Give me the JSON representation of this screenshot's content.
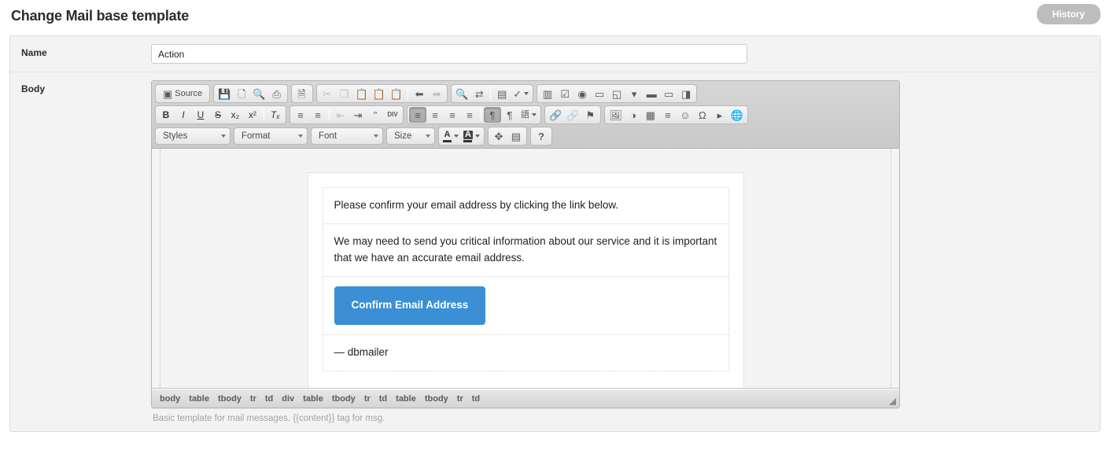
{
  "header": {
    "title": "Change Mail base template",
    "history_label": "History"
  },
  "form": {
    "name_row": {
      "label": "Name",
      "value": "Action",
      "placeholder": ""
    },
    "body_row": {
      "label": "Body",
      "help_text": "Basic template for mail messages. {{content}} tag for msg."
    }
  },
  "editor": {
    "toolbar_row1": [
      {
        "group": "document",
        "buttons": [
          {
            "name": "source-button",
            "label": "Source",
            "icon": "source-icon",
            "glyph": "▣",
            "state": "normal",
            "wide": true
          }
        ]
      },
      {
        "group": "document-2",
        "buttons": [
          {
            "name": "save-button",
            "label": "",
            "icon": "save-icon",
            "glyph": "💾",
            "state": "normal"
          },
          {
            "name": "new-page-button",
            "label": "",
            "icon": "new-page-icon",
            "glyph": "🗋",
            "state": "normal"
          },
          {
            "name": "preview-button",
            "label": "",
            "icon": "preview-icon",
            "glyph": "🔍",
            "state": "normal"
          },
          {
            "name": "print-button",
            "label": "",
            "icon": "print-icon",
            "glyph": "⎙",
            "state": "normal"
          }
        ]
      },
      {
        "group": "templates",
        "buttons": [
          {
            "name": "templates-button",
            "label": "",
            "icon": "templates-icon",
            "glyph": "🗎",
            "state": "normal"
          }
        ]
      },
      {
        "group": "clipboard",
        "buttons": [
          {
            "name": "cut-button",
            "label": "",
            "icon": "scissors-icon",
            "glyph": "✂",
            "state": "disabled"
          },
          {
            "name": "copy-button",
            "label": "",
            "icon": "copy-icon",
            "glyph": "❐",
            "state": "disabled"
          },
          {
            "name": "paste-button",
            "label": "",
            "icon": "paste-icon",
            "glyph": "📋",
            "state": "normal"
          },
          {
            "name": "paste-text-button",
            "label": "",
            "icon": "paste-text-icon",
            "glyph": "📋",
            "state": "normal"
          },
          {
            "name": "paste-word-button",
            "label": "",
            "icon": "paste-word-icon",
            "glyph": "📋",
            "state": "normal"
          },
          {
            "name": "separator",
            "label": "",
            "icon": "separator",
            "glyph": "",
            "state": "sep"
          },
          {
            "name": "undo-button",
            "label": "",
            "icon": "undo-icon",
            "glyph": "⬅",
            "state": "normal"
          },
          {
            "name": "redo-button",
            "label": "",
            "icon": "redo-icon",
            "glyph": "➡",
            "state": "disabled"
          }
        ]
      },
      {
        "group": "editing",
        "buttons": [
          {
            "name": "find-button",
            "label": "",
            "icon": "search-icon",
            "glyph": "🔍",
            "state": "normal"
          },
          {
            "name": "replace-button",
            "label": "",
            "icon": "replace-icon",
            "glyph": "⇄",
            "state": "normal"
          },
          {
            "name": "separator",
            "label": "",
            "icon": "separator",
            "glyph": "",
            "state": "sep"
          },
          {
            "name": "select-all-button",
            "label": "",
            "icon": "select-all-icon",
            "glyph": "▤",
            "state": "normal"
          },
          {
            "name": "spellcheck-button",
            "label": "",
            "icon": "spellcheck-icon",
            "glyph": "✓",
            "state": "menu"
          }
        ]
      },
      {
        "group": "forms",
        "buttons": [
          {
            "name": "form-button",
            "label": "",
            "icon": "form-icon",
            "glyph": "▥",
            "state": "normal"
          },
          {
            "name": "checkbox-button",
            "label": "",
            "icon": "checkbox-icon",
            "glyph": "☑",
            "state": "normal"
          },
          {
            "name": "radio-button",
            "label": "",
            "icon": "radio-icon",
            "glyph": "◉",
            "state": "normal"
          },
          {
            "name": "text-field-button",
            "label": "",
            "icon": "text-field-icon",
            "glyph": "▭",
            "state": "normal"
          },
          {
            "name": "textarea-button",
            "label": "",
            "icon": "textarea-icon",
            "glyph": "◱",
            "state": "normal"
          },
          {
            "name": "select-field-button",
            "label": "",
            "icon": "select-field-icon",
            "glyph": "▾",
            "state": "normal"
          },
          {
            "name": "button-field-button",
            "label": "",
            "icon": "button-field-icon",
            "glyph": "▬",
            "state": "normal"
          },
          {
            "name": "image-button-button",
            "label": "",
            "icon": "image-button-icon",
            "glyph": "▭",
            "state": "normal"
          },
          {
            "name": "hidden-field-button",
            "label": "",
            "icon": "hidden-field-icon",
            "glyph": "◨",
            "state": "normal"
          }
        ]
      }
    ],
    "toolbar_row2": [
      {
        "group": "basicstyles",
        "buttons": [
          {
            "name": "bold-button",
            "label": "B",
            "icon": "bold-icon",
            "glyph": "B",
            "state": "normal",
            "text": true,
            "style": "bold"
          },
          {
            "name": "italic-button",
            "label": "I",
            "icon": "italic-icon",
            "glyph": "I",
            "state": "normal",
            "text": true,
            "style": "italic"
          },
          {
            "name": "underline-button",
            "label": "U",
            "icon": "underline-icon",
            "glyph": "U",
            "state": "normal",
            "text": true,
            "style": "underline"
          },
          {
            "name": "strike-button",
            "label": "S",
            "icon": "strikethrough-icon",
            "glyph": "S",
            "state": "normal",
            "text": true,
            "style": "strike"
          },
          {
            "name": "subscript-button",
            "label": "x₂",
            "icon": "subscript-icon",
            "glyph": "x₂",
            "state": "normal",
            "text": true
          },
          {
            "name": "superscript-button",
            "label": "x²",
            "icon": "superscript-icon",
            "glyph": "x²",
            "state": "normal",
            "text": true
          },
          {
            "name": "separator",
            "label": "",
            "icon": "separator",
            "glyph": "",
            "state": "sep"
          },
          {
            "name": "remove-format-button",
            "label": "Tₓ",
            "icon": "remove-format-icon",
            "glyph": "Tₓ",
            "state": "normal",
            "text": true,
            "style": "italic"
          }
        ]
      },
      {
        "group": "paragraph",
        "buttons": [
          {
            "name": "numbered-list-button",
            "label": "",
            "icon": "numbered-list-icon",
            "glyph": "≡",
            "state": "normal"
          },
          {
            "name": "bulleted-list-button",
            "label": "",
            "icon": "bulleted-list-icon",
            "glyph": "≡",
            "state": "normal"
          },
          {
            "name": "separator",
            "label": "",
            "icon": "separator",
            "glyph": "",
            "state": "sep"
          },
          {
            "name": "outdent-button",
            "label": "",
            "icon": "outdent-icon",
            "glyph": "⇤",
            "state": "disabled"
          },
          {
            "name": "indent-button",
            "label": "",
            "icon": "indent-icon",
            "glyph": "⇥",
            "state": "normal"
          },
          {
            "name": "blockquote-button",
            "label": "",
            "icon": "blockquote-icon",
            "glyph": "”",
            "state": "normal"
          },
          {
            "name": "create-div-button",
            "label": "",
            "icon": "div-container-icon",
            "glyph": "DIV",
            "state": "normal"
          }
        ]
      },
      {
        "group": "align",
        "buttons": [
          {
            "name": "align-left-button",
            "label": "",
            "icon": "align-left-icon",
            "glyph": "≡",
            "state": "on"
          },
          {
            "name": "align-center-button",
            "label": "",
            "icon": "align-center-icon",
            "glyph": "≡",
            "state": "normal"
          },
          {
            "name": "align-right-button",
            "label": "",
            "icon": "align-right-icon",
            "glyph": "≡",
            "state": "normal"
          },
          {
            "name": "align-justify-button",
            "label": "",
            "icon": "align-justify-icon",
            "glyph": "≡",
            "state": "normal"
          },
          {
            "name": "separator",
            "label": "",
            "icon": "separator",
            "glyph": "",
            "state": "sep"
          },
          {
            "name": "text-direction-ltr-button",
            "label": "",
            "icon": "direction-ltr-icon",
            "glyph": "¶",
            "state": "on"
          },
          {
            "name": "text-direction-rtl-button",
            "label": "",
            "icon": "direction-rtl-icon",
            "glyph": "¶",
            "state": "normal"
          },
          {
            "name": "language-button",
            "label": "",
            "icon": "language-icon",
            "glyph": "語",
            "state": "menu"
          }
        ]
      },
      {
        "group": "links",
        "buttons": [
          {
            "name": "link-button",
            "label": "",
            "icon": "link-icon",
            "glyph": "🔗",
            "state": "normal"
          },
          {
            "name": "unlink-button",
            "label": "",
            "icon": "unlink-icon",
            "glyph": "🔗",
            "state": "disabled"
          },
          {
            "name": "anchor-button",
            "label": "",
            "icon": "anchor-flag-icon",
            "glyph": "⚑",
            "state": "normal"
          }
        ]
      },
      {
        "group": "insert",
        "buttons": [
          {
            "name": "image-button",
            "label": "",
            "icon": "image-icon",
            "glyph": "🖼",
            "state": "normal"
          },
          {
            "name": "flash-button",
            "label": "",
            "icon": "flash-icon",
            "glyph": "◑",
            "state": "normal"
          },
          {
            "name": "table-button",
            "label": "",
            "icon": "table-icon",
            "glyph": "▦",
            "state": "normal"
          },
          {
            "name": "horizontal-rule-button",
            "label": "",
            "icon": "horizontal-rule-icon",
            "glyph": "≡",
            "state": "normal"
          },
          {
            "name": "smiley-button",
            "label": "",
            "icon": "smiley-icon",
            "glyph": "☺",
            "state": "normal"
          },
          {
            "name": "special-char-button",
            "label": "",
            "icon": "omega-icon",
            "glyph": "Ω",
            "state": "normal"
          },
          {
            "name": "page-break-button",
            "label": "",
            "icon": "page-break-icon",
            "glyph": "▸",
            "state": "normal"
          },
          {
            "name": "iframe-button",
            "label": "",
            "icon": "globe-icon",
            "glyph": "🌐",
            "state": "normal"
          }
        ]
      }
    ],
    "toolbar_row3": {
      "combos": [
        {
          "name": "styles-combo",
          "label": "Styles"
        },
        {
          "name": "format-combo",
          "label": "Format"
        },
        {
          "name": "font-combo",
          "label": "Font"
        },
        {
          "name": "size-combo",
          "label": "Size"
        }
      ],
      "colors": [
        {
          "name": "text-color-button",
          "label": "A",
          "icon": "text-color-icon"
        },
        {
          "name": "background-color-button",
          "label": "A",
          "icon": "background-color-icon"
        }
      ],
      "tools": [
        {
          "name": "maximize-button",
          "label": "",
          "icon": "maximize-icon",
          "glyph": "✥"
        },
        {
          "name": "show-blocks-button",
          "label": "",
          "icon": "show-blocks-icon",
          "glyph": "▤"
        }
      ],
      "about": {
        "name": "about-button",
        "label": "?",
        "icon": "help-icon"
      }
    },
    "content": {
      "paragraph_1": "Please confirm your email address by clicking the link below.",
      "paragraph_2": "We may need to send you critical information about our service and it is important that we have an accurate email address.",
      "cta_label": "Confirm Email Address",
      "cta_color": "#3b8fd4",
      "signature": "— dbmailer"
    },
    "element_path": [
      "body",
      "table",
      "tbody",
      "tr",
      "td",
      "div",
      "table",
      "tbody",
      "tr",
      "td",
      "table",
      "tbody",
      "tr",
      "td"
    ]
  }
}
